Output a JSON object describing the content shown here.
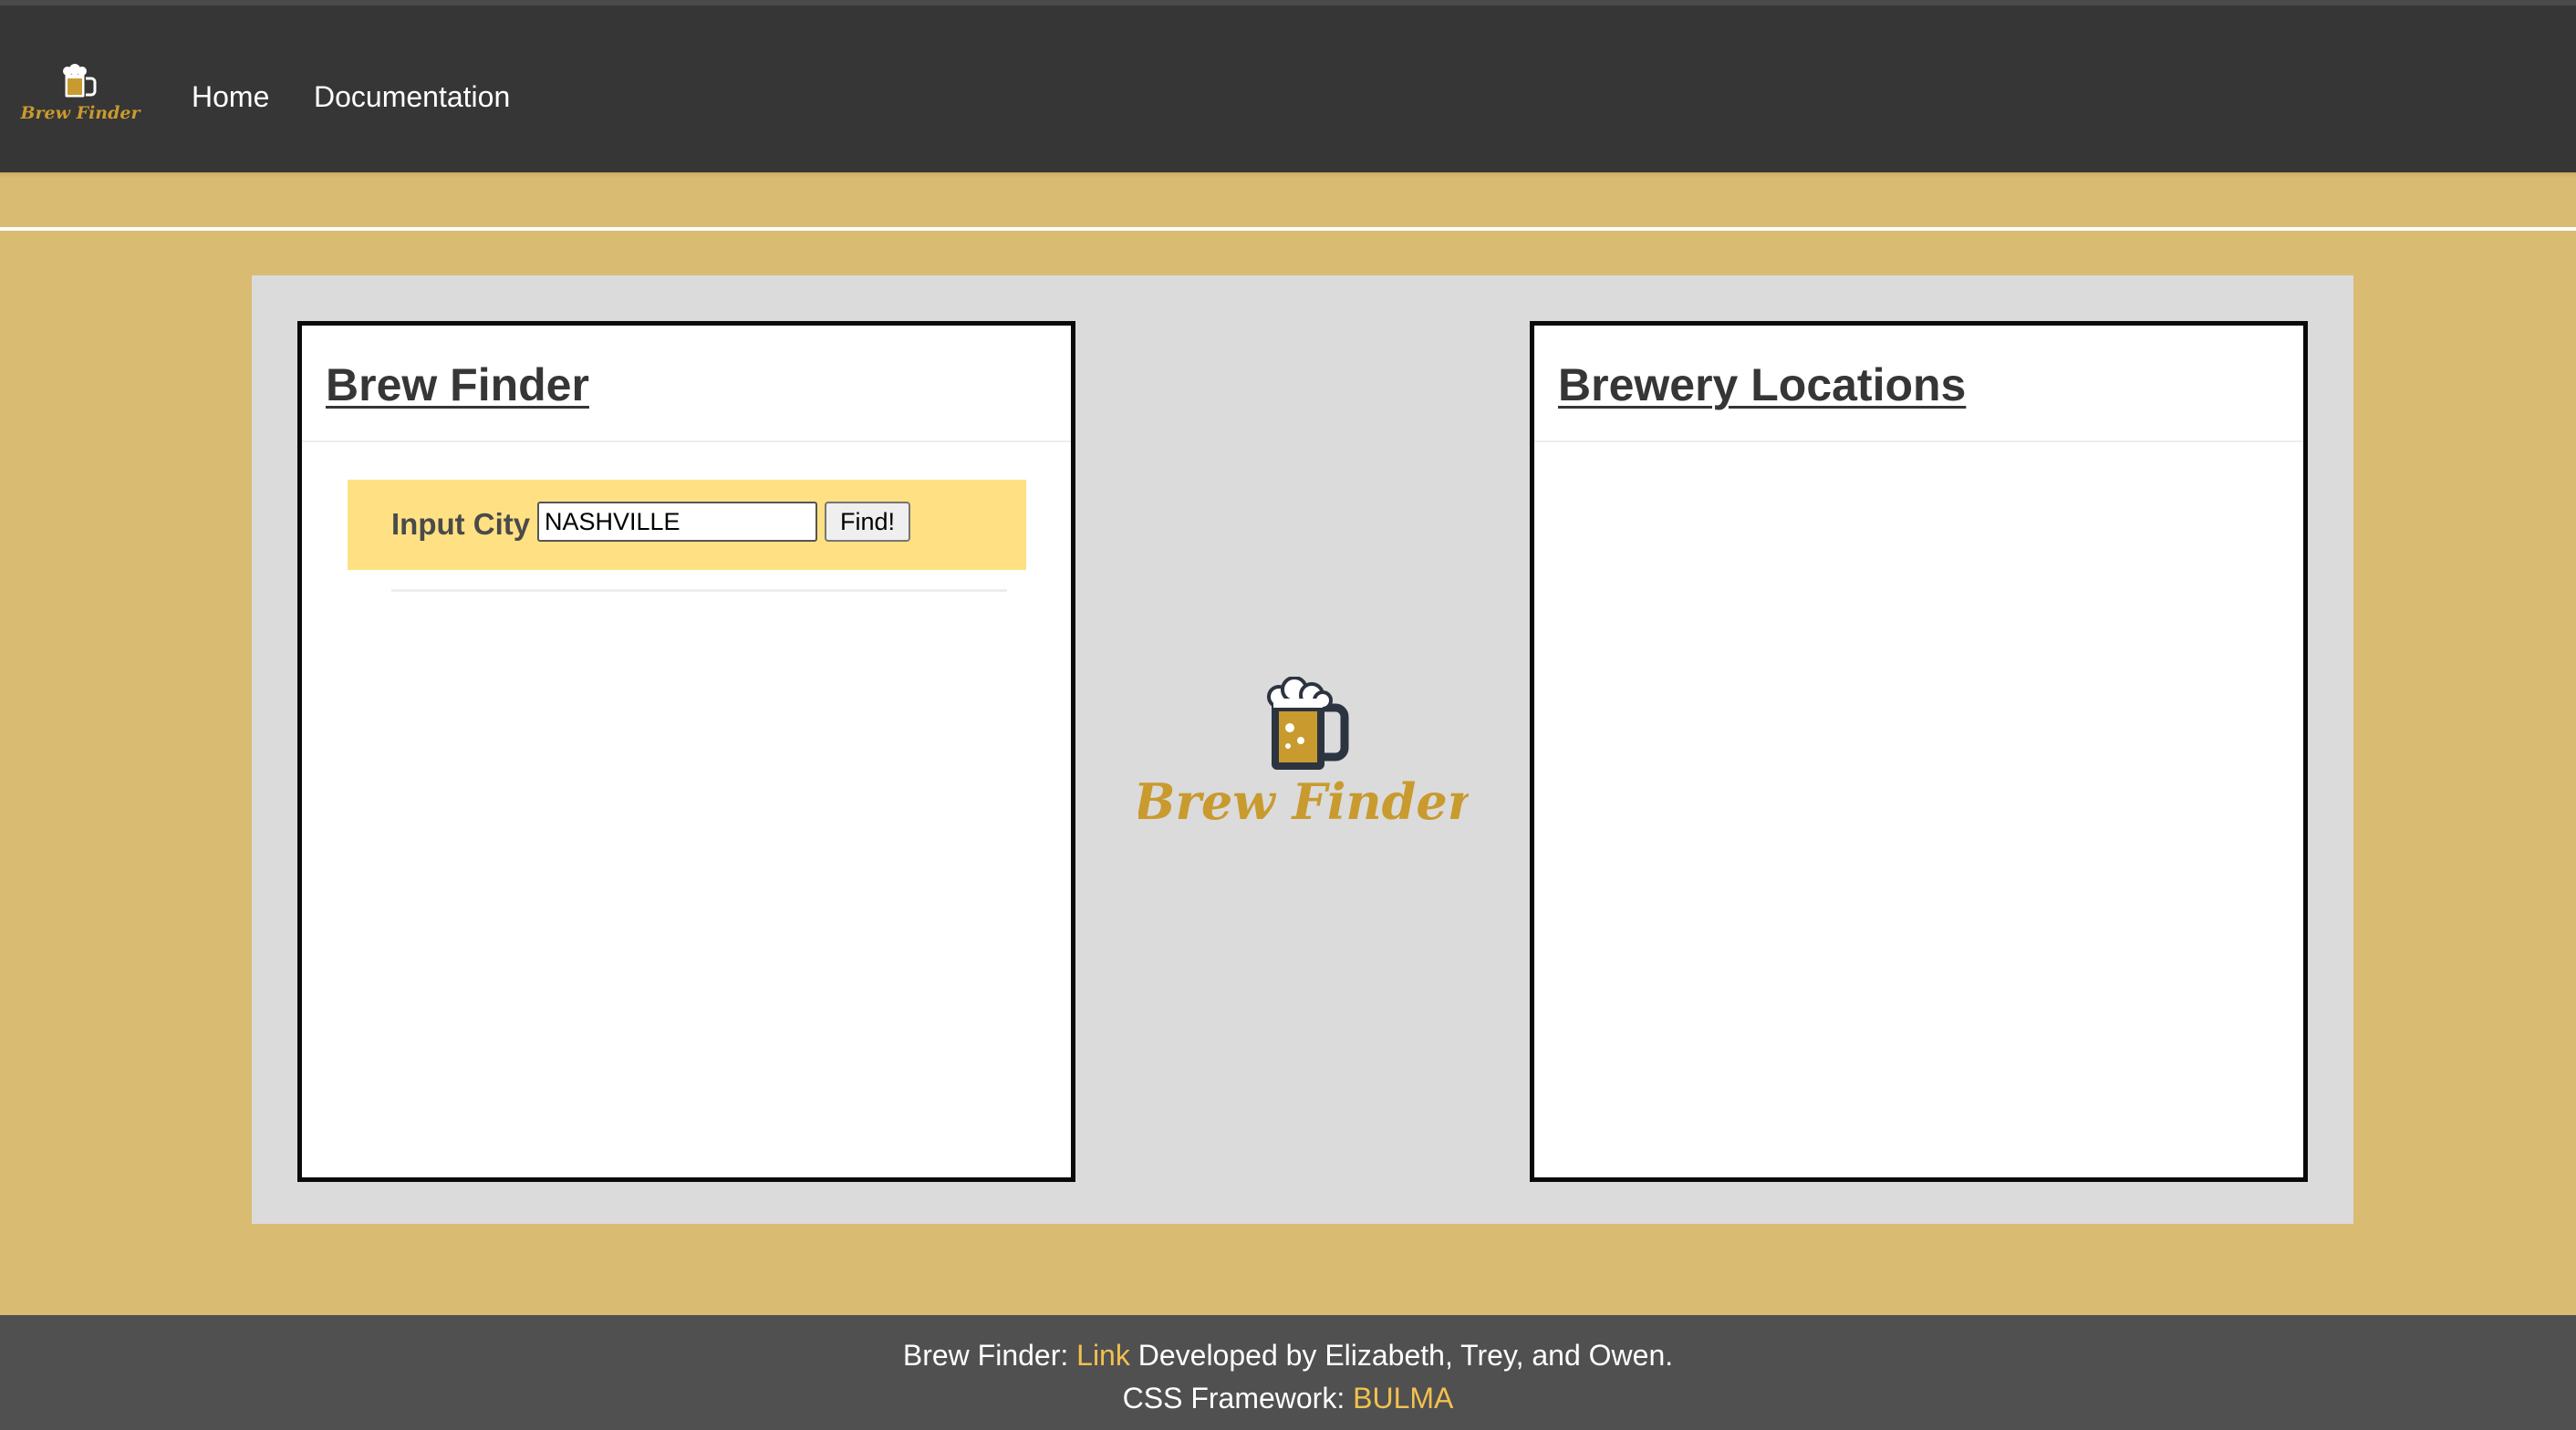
{
  "navbar": {
    "logo_text": "Brew Finder",
    "links": [
      {
        "label": "Home"
      },
      {
        "label": "Documentation"
      }
    ]
  },
  "main": {
    "left_card": {
      "title": "Brew Finder",
      "input_label": "Input City",
      "input_value": "NASHVILLE",
      "button_label": "Find!"
    },
    "center_logo_text": "Brew Finder",
    "right_card": {
      "title": "Brewery Locations"
    }
  },
  "footer": {
    "line1_prefix": "Brew Finder: ",
    "line1_link": "Link",
    "line1_suffix": " Developed by Elizabeth, Trey, and Owen.",
    "line2_prefix": "CSS Framework: ",
    "line2_link": "BULMA"
  },
  "colors": {
    "navbar_bg": "#363636",
    "page_bg": "#d9bc72",
    "content_bg": "#dbdbdb",
    "input_bar_bg": "#ffe183",
    "logo_gold": "#c99a2e",
    "footer_bg": "#505050",
    "footer_link": "#f2c14e"
  },
  "icons": {
    "logo_icon": "beer-mug-icon"
  }
}
